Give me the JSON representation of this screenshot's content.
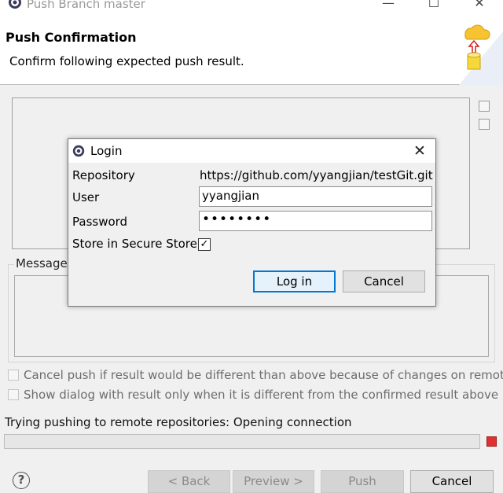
{
  "window": {
    "title": "Push Branch master"
  },
  "header": {
    "title": "Push Confirmation",
    "subtitle": "Confirm following expected push result."
  },
  "message": {
    "label": "Message"
  },
  "options": {
    "cancel_if_different": {
      "label": "Cancel push if result would be different than above because of changes on remote",
      "checked": false
    },
    "show_dialog_only_if_different": {
      "label": "Show dialog with result only when it is different from the confirmed result above",
      "checked": false
    }
  },
  "status": {
    "text": "Trying pushing to remote repositories: Opening connection",
    "progress": 0
  },
  "footer": {
    "back": "< Back",
    "preview": "Preview >",
    "push": "Push",
    "cancel": "Cancel"
  },
  "login": {
    "title": "Login",
    "repository_label": "Repository",
    "repository_value": "https://github.com/yyangjian/testGit.git",
    "user_label": "User",
    "user_value": "yyangjian",
    "password_label": "Password",
    "password_masked": "••••••••",
    "store_label": "Store in Secure Store",
    "store_checked": true,
    "store_check_glyph": "✓",
    "login_button": "Log in",
    "cancel_button": "Cancel"
  },
  "icons": {
    "window": "eclipse-gear-icon",
    "wizard": "push-to-cloud-icon",
    "help": "help-icon",
    "stop": "stop-icon"
  },
  "colors": {
    "accent": "#0078d7",
    "stop": "#e03131",
    "dialog_bg": "#f0f0f0"
  }
}
